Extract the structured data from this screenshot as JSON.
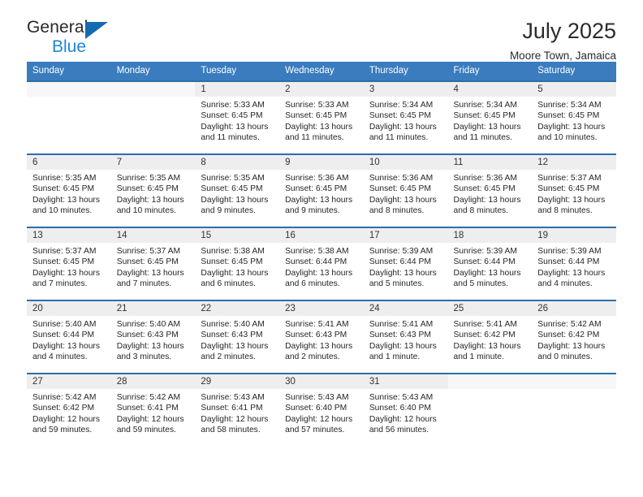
{
  "brand": {
    "name_part1": "General",
    "name_part2": "Blue",
    "triangle_icon": "triangle-icon",
    "accent_blue": "#1f86d8",
    "logo_dark": "#26282b"
  },
  "header": {
    "title": "July 2025",
    "subtitle": "Moore Town, Jamaica"
  },
  "theme": {
    "header_bg": "#3a7cbe",
    "row_separator": "#2e6da8",
    "daynum_band": "#eeeeee",
    "text": "#262626"
  },
  "weekday_headers": [
    "Sunday",
    "Monday",
    "Tuesday",
    "Wednesday",
    "Thursday",
    "Friday",
    "Saturday"
  ],
  "labels": {
    "sunrise_prefix": "Sunrise:",
    "sunset_prefix": "Sunset:",
    "daylight_prefix": "Daylight:"
  },
  "weeks": [
    [
      {
        "day": "",
        "sunrise": "",
        "sunset": "",
        "daylight_line1": "",
        "daylight_line2": ""
      },
      {
        "day": "",
        "sunrise": "",
        "sunset": "",
        "daylight_line1": "",
        "daylight_line2": ""
      },
      {
        "day": "1",
        "sunrise": "Sunrise: 5:33 AM",
        "sunset": "Sunset: 6:45 PM",
        "daylight_line1": "Daylight: 13 hours",
        "daylight_line2": "and 11 minutes."
      },
      {
        "day": "2",
        "sunrise": "Sunrise: 5:33 AM",
        "sunset": "Sunset: 6:45 PM",
        "daylight_line1": "Daylight: 13 hours",
        "daylight_line2": "and 11 minutes."
      },
      {
        "day": "3",
        "sunrise": "Sunrise: 5:34 AM",
        "sunset": "Sunset: 6:45 PM",
        "daylight_line1": "Daylight: 13 hours",
        "daylight_line2": "and 11 minutes."
      },
      {
        "day": "4",
        "sunrise": "Sunrise: 5:34 AM",
        "sunset": "Sunset: 6:45 PM",
        "daylight_line1": "Daylight: 13 hours",
        "daylight_line2": "and 11 minutes."
      },
      {
        "day": "5",
        "sunrise": "Sunrise: 5:34 AM",
        "sunset": "Sunset: 6:45 PM",
        "daylight_line1": "Daylight: 13 hours",
        "daylight_line2": "and 10 minutes."
      }
    ],
    [
      {
        "day": "6",
        "sunrise": "Sunrise: 5:35 AM",
        "sunset": "Sunset: 6:45 PM",
        "daylight_line1": "Daylight: 13 hours",
        "daylight_line2": "and 10 minutes."
      },
      {
        "day": "7",
        "sunrise": "Sunrise: 5:35 AM",
        "sunset": "Sunset: 6:45 PM",
        "daylight_line1": "Daylight: 13 hours",
        "daylight_line2": "and 10 minutes."
      },
      {
        "day": "8",
        "sunrise": "Sunrise: 5:35 AM",
        "sunset": "Sunset: 6:45 PM",
        "daylight_line1": "Daylight: 13 hours",
        "daylight_line2": "and 9 minutes."
      },
      {
        "day": "9",
        "sunrise": "Sunrise: 5:36 AM",
        "sunset": "Sunset: 6:45 PM",
        "daylight_line1": "Daylight: 13 hours",
        "daylight_line2": "and 9 minutes."
      },
      {
        "day": "10",
        "sunrise": "Sunrise: 5:36 AM",
        "sunset": "Sunset: 6:45 PM",
        "daylight_line1": "Daylight: 13 hours",
        "daylight_line2": "and 8 minutes."
      },
      {
        "day": "11",
        "sunrise": "Sunrise: 5:36 AM",
        "sunset": "Sunset: 6:45 PM",
        "daylight_line1": "Daylight: 13 hours",
        "daylight_line2": "and 8 minutes."
      },
      {
        "day": "12",
        "sunrise": "Sunrise: 5:37 AM",
        "sunset": "Sunset: 6:45 PM",
        "daylight_line1": "Daylight: 13 hours",
        "daylight_line2": "and 8 minutes."
      }
    ],
    [
      {
        "day": "13",
        "sunrise": "Sunrise: 5:37 AM",
        "sunset": "Sunset: 6:45 PM",
        "daylight_line1": "Daylight: 13 hours",
        "daylight_line2": "and 7 minutes."
      },
      {
        "day": "14",
        "sunrise": "Sunrise: 5:37 AM",
        "sunset": "Sunset: 6:45 PM",
        "daylight_line1": "Daylight: 13 hours",
        "daylight_line2": "and 7 minutes."
      },
      {
        "day": "15",
        "sunrise": "Sunrise: 5:38 AM",
        "sunset": "Sunset: 6:45 PM",
        "daylight_line1": "Daylight: 13 hours",
        "daylight_line2": "and 6 minutes."
      },
      {
        "day": "16",
        "sunrise": "Sunrise: 5:38 AM",
        "sunset": "Sunset: 6:44 PM",
        "daylight_line1": "Daylight: 13 hours",
        "daylight_line2": "and 6 minutes."
      },
      {
        "day": "17",
        "sunrise": "Sunrise: 5:39 AM",
        "sunset": "Sunset: 6:44 PM",
        "daylight_line1": "Daylight: 13 hours",
        "daylight_line2": "and 5 minutes."
      },
      {
        "day": "18",
        "sunrise": "Sunrise: 5:39 AM",
        "sunset": "Sunset: 6:44 PM",
        "daylight_line1": "Daylight: 13 hours",
        "daylight_line2": "and 5 minutes."
      },
      {
        "day": "19",
        "sunrise": "Sunrise: 5:39 AM",
        "sunset": "Sunset: 6:44 PM",
        "daylight_line1": "Daylight: 13 hours",
        "daylight_line2": "and 4 minutes."
      }
    ],
    [
      {
        "day": "20",
        "sunrise": "Sunrise: 5:40 AM",
        "sunset": "Sunset: 6:44 PM",
        "daylight_line1": "Daylight: 13 hours",
        "daylight_line2": "and 4 minutes."
      },
      {
        "day": "21",
        "sunrise": "Sunrise: 5:40 AM",
        "sunset": "Sunset: 6:43 PM",
        "daylight_line1": "Daylight: 13 hours",
        "daylight_line2": "and 3 minutes."
      },
      {
        "day": "22",
        "sunrise": "Sunrise: 5:40 AM",
        "sunset": "Sunset: 6:43 PM",
        "daylight_line1": "Daylight: 13 hours",
        "daylight_line2": "and 2 minutes."
      },
      {
        "day": "23",
        "sunrise": "Sunrise: 5:41 AM",
        "sunset": "Sunset: 6:43 PM",
        "daylight_line1": "Daylight: 13 hours",
        "daylight_line2": "and 2 minutes."
      },
      {
        "day": "24",
        "sunrise": "Sunrise: 5:41 AM",
        "sunset": "Sunset: 6:43 PM",
        "daylight_line1": "Daylight: 13 hours",
        "daylight_line2": "and 1 minute."
      },
      {
        "day": "25",
        "sunrise": "Sunrise: 5:41 AM",
        "sunset": "Sunset: 6:42 PM",
        "daylight_line1": "Daylight: 13 hours",
        "daylight_line2": "and 1 minute."
      },
      {
        "day": "26",
        "sunrise": "Sunrise: 5:42 AM",
        "sunset": "Sunset: 6:42 PM",
        "daylight_line1": "Daylight: 13 hours",
        "daylight_line2": "and 0 minutes."
      }
    ],
    [
      {
        "day": "27",
        "sunrise": "Sunrise: 5:42 AM",
        "sunset": "Sunset: 6:42 PM",
        "daylight_line1": "Daylight: 12 hours",
        "daylight_line2": "and 59 minutes."
      },
      {
        "day": "28",
        "sunrise": "Sunrise: 5:42 AM",
        "sunset": "Sunset: 6:41 PM",
        "daylight_line1": "Daylight: 12 hours",
        "daylight_line2": "and 59 minutes."
      },
      {
        "day": "29",
        "sunrise": "Sunrise: 5:43 AM",
        "sunset": "Sunset: 6:41 PM",
        "daylight_line1": "Daylight: 12 hours",
        "daylight_line2": "and 58 minutes."
      },
      {
        "day": "30",
        "sunrise": "Sunrise: 5:43 AM",
        "sunset": "Sunset: 6:40 PM",
        "daylight_line1": "Daylight: 12 hours",
        "daylight_line2": "and 57 minutes."
      },
      {
        "day": "31",
        "sunrise": "Sunrise: 5:43 AM",
        "sunset": "Sunset: 6:40 PM",
        "daylight_line1": "Daylight: 12 hours",
        "daylight_line2": "and 56 minutes."
      },
      {
        "day": "",
        "sunrise": "",
        "sunset": "",
        "daylight_line1": "",
        "daylight_line2": ""
      },
      {
        "day": "",
        "sunrise": "",
        "sunset": "",
        "daylight_line1": "",
        "daylight_line2": ""
      }
    ]
  ]
}
